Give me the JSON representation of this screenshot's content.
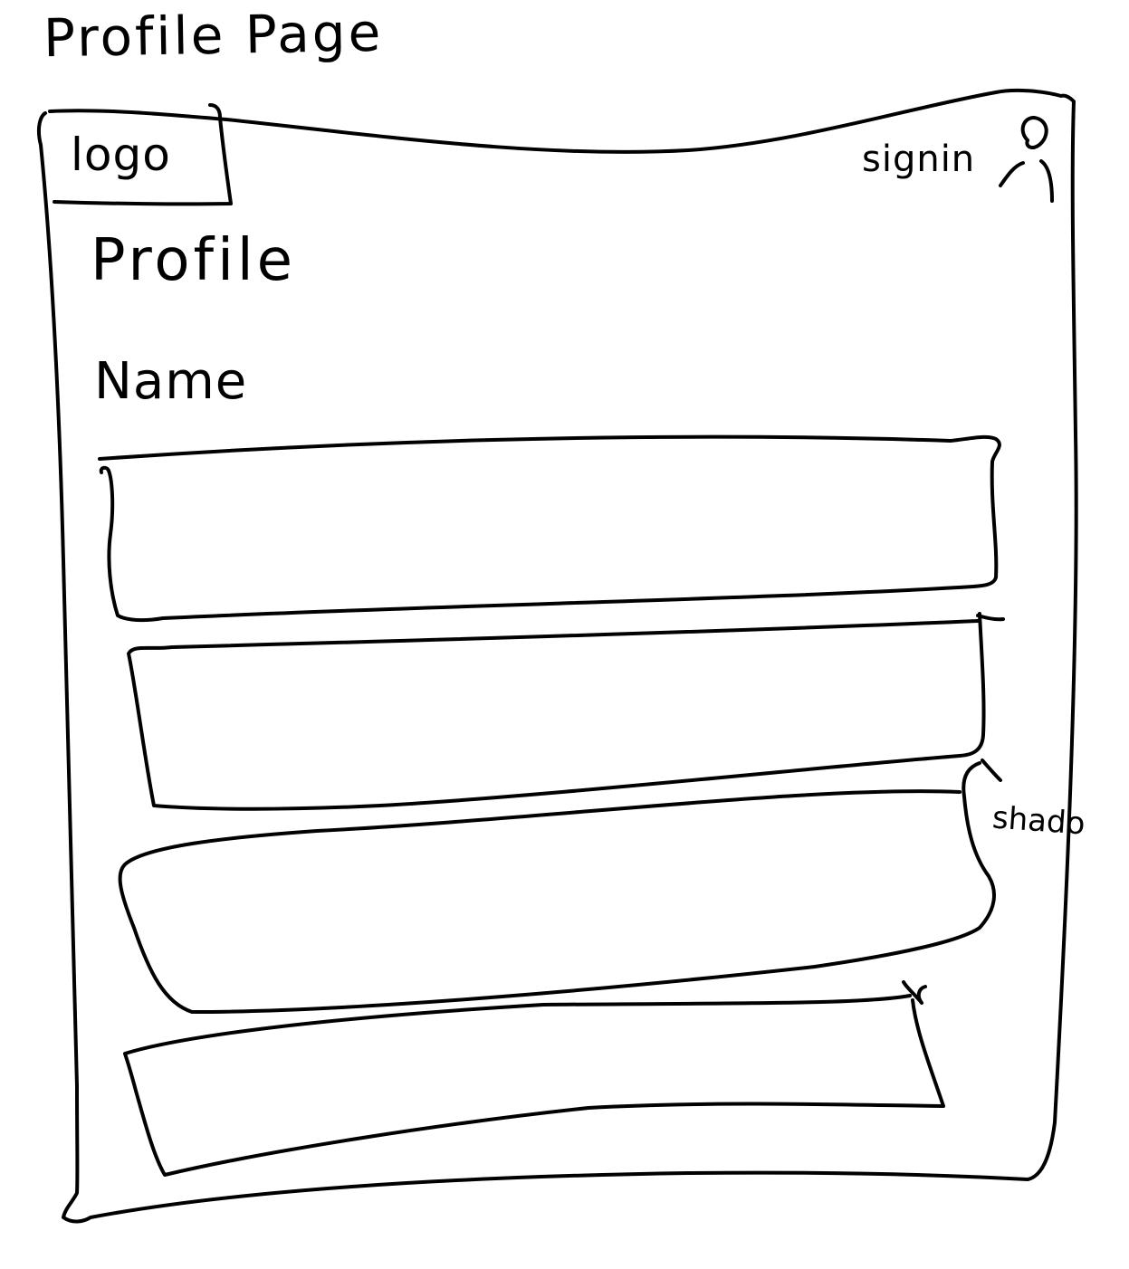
{
  "page_title": "Profile Page",
  "header": {
    "logo_label": "logo",
    "signin_label": "signin"
  },
  "main": {
    "section_title": "Profile",
    "name_label": "Name",
    "fields": [
      {
        "value": "",
        "placeholder": ""
      },
      {
        "value": "",
        "placeholder": ""
      },
      {
        "value": "",
        "placeholder": ""
      },
      {
        "value": "",
        "placeholder": ""
      }
    ],
    "annotation": "shado"
  },
  "colors": {
    "ink": "#000000",
    "paper": "#ffffff"
  },
  "icons": {
    "signin": "user-icon"
  }
}
